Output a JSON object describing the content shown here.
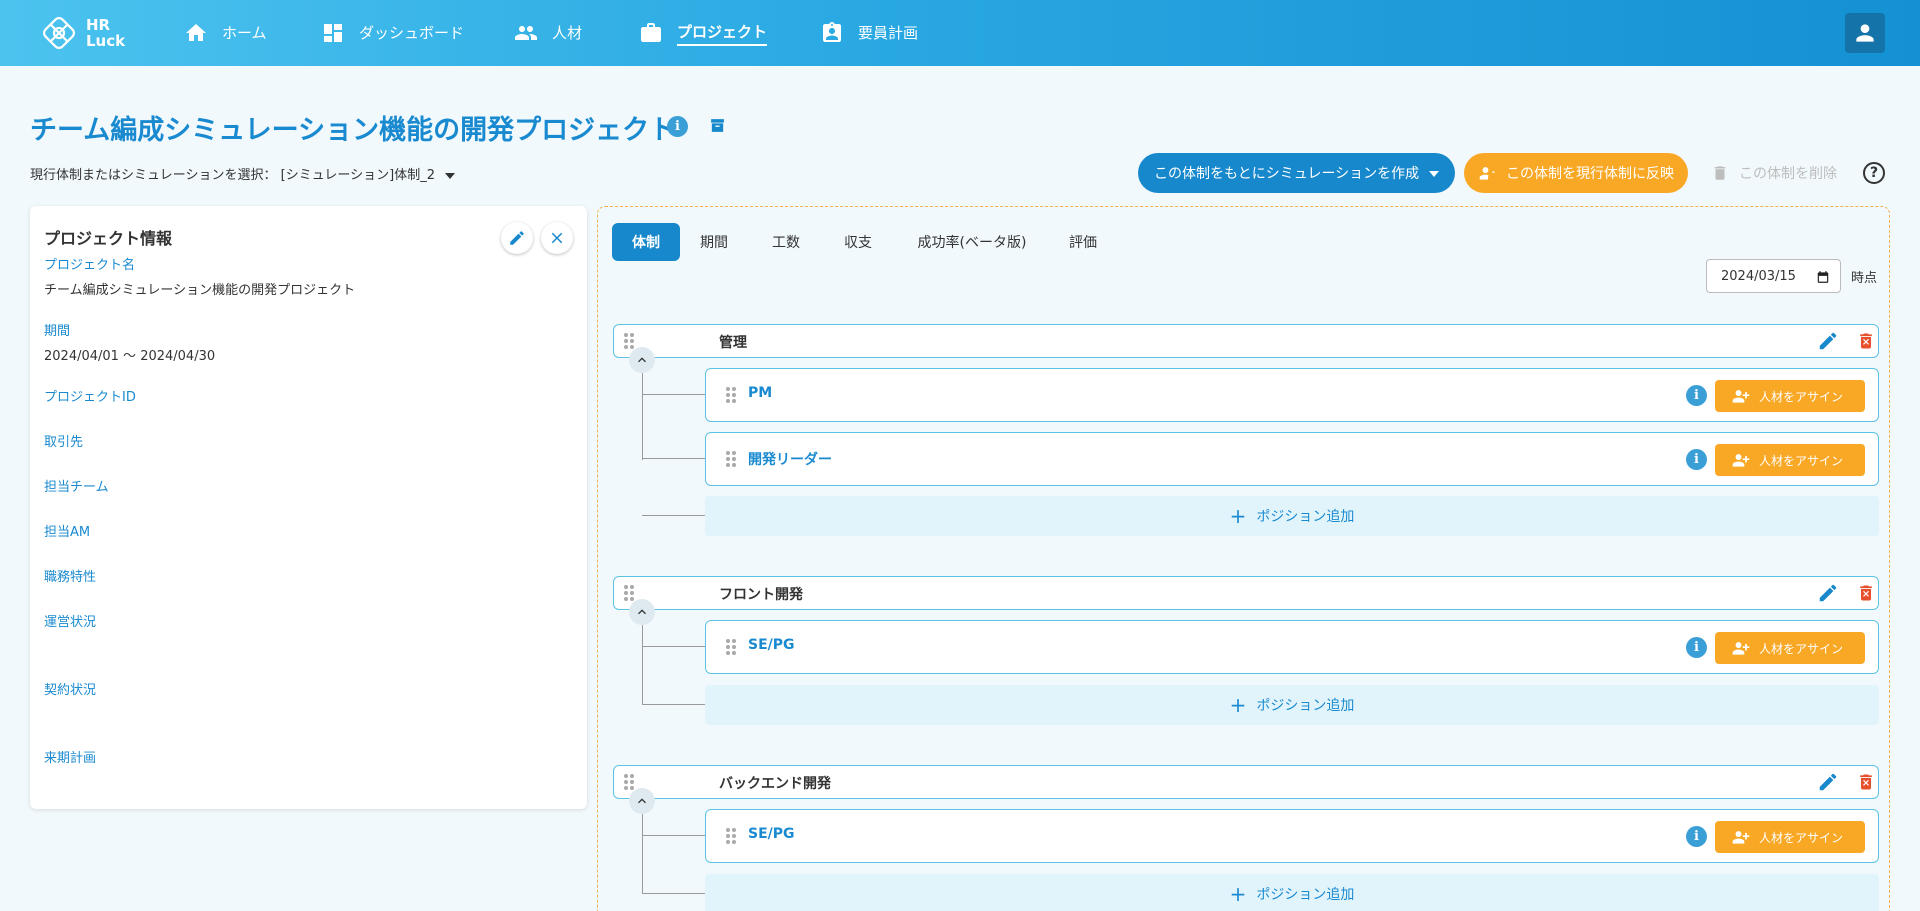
{
  "app": {
    "logo_text_1": "HR",
    "logo_text_2": "Luck"
  },
  "nav": [
    {
      "label": "ホーム",
      "icon": "home-icon"
    },
    {
      "label": "ダッシュボード",
      "icon": "dashboard-icon"
    },
    {
      "label": "人材",
      "icon": "people-icon"
    },
    {
      "label": "プロジェクト",
      "icon": "briefcase-icon",
      "active": true
    },
    {
      "label": "要員計画",
      "icon": "badge-icon"
    }
  ],
  "page": {
    "title": "チーム編成シミュレーション機能の開発プロジェクト",
    "selector_label": "現行体制またはシミュレーションを選択：",
    "selector_value": "[シミュレーション]体制_2"
  },
  "actions": {
    "create_sim": "この体制をもとにシミュレーションを作成",
    "reflect": "この体制を現行体制に反映",
    "delete": "この体制を削除",
    "help": "?"
  },
  "project_info": {
    "title": "プロジェクト情報",
    "fields": [
      {
        "label": "プロジェクト名",
        "value": "チーム編成シミュレーション機能の開発プロジェクト"
      },
      {
        "label": "期間",
        "value": "2024/04/01 〜 2024/04/30"
      },
      {
        "label": "プロジェクトID",
        "value": ""
      },
      {
        "label": "取引先",
        "value": ""
      },
      {
        "label": "担当チーム",
        "value": ""
      },
      {
        "label": "担当AM",
        "value": ""
      },
      {
        "label": "職務特性",
        "value": ""
      },
      {
        "label": "運営状況",
        "value": ""
      },
      {
        "label": "契約状況",
        "value": ""
      },
      {
        "label": "来期計画",
        "value": ""
      }
    ]
  },
  "tabs": [
    "体制",
    "期間",
    "工数",
    "収支",
    "成功率(ベータ版)",
    "評価"
  ],
  "date": {
    "value": "2024/03/15",
    "suffix": "時点"
  },
  "org": {
    "assign_label": "人材をアサイン",
    "add_position_label": "ポジション追加",
    "groups": [
      {
        "name": "管理",
        "positions": [
          "PM",
          "開発リーダー"
        ]
      },
      {
        "name": "フロント開発",
        "positions": [
          "SE/PG"
        ]
      },
      {
        "name": "バックエンド開発",
        "positions": [
          "SE/PG"
        ]
      }
    ]
  },
  "colors": {
    "primary": "#1788cc",
    "accent": "#f9a826",
    "danger": "#e7502c",
    "row_border": "#5cc3e2"
  }
}
